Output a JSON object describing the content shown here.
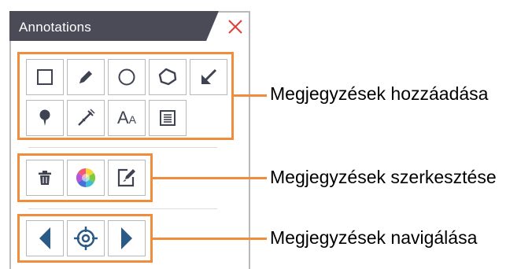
{
  "panel": {
    "title": "Annotations",
    "close_icon": "close-x-icon"
  },
  "colors": {
    "title_bar": "#4a4b57",
    "close": "#e0403a",
    "highlight": "#ef8d3d",
    "icon": "#3f4250",
    "nav_arrow": "#2b5a86"
  },
  "groups": {
    "add": {
      "tools": [
        {
          "name": "rectangle",
          "icon": "square-icon"
        },
        {
          "name": "pen",
          "icon": "pencil-icon"
        },
        {
          "name": "ellipse",
          "icon": "circle-icon"
        },
        {
          "name": "polygon",
          "icon": "polygon-icon"
        },
        {
          "name": "arrow",
          "icon": "arrow-icon"
        },
        {
          "name": "pin",
          "icon": "pin-icon"
        },
        {
          "name": "measure",
          "icon": "measure-icon"
        },
        {
          "name": "text",
          "icon": "text-icon",
          "label": "AA"
        },
        {
          "name": "note",
          "icon": "note-icon"
        }
      ],
      "callout": "Megjegyzések hozzáadása"
    },
    "edit": {
      "tools": [
        {
          "name": "delete",
          "icon": "trash-icon"
        },
        {
          "name": "color",
          "icon": "color-wheel-icon"
        },
        {
          "name": "edit",
          "icon": "edit-icon"
        }
      ],
      "callout": "Megjegyzések szerkesztése"
    },
    "navigate": {
      "tools": [
        {
          "name": "previous",
          "icon": "triangle-left-icon"
        },
        {
          "name": "locate",
          "icon": "crosshair-icon"
        },
        {
          "name": "next",
          "icon": "triangle-right-icon"
        }
      ],
      "callout": "Megjegyzések navigálása"
    }
  }
}
